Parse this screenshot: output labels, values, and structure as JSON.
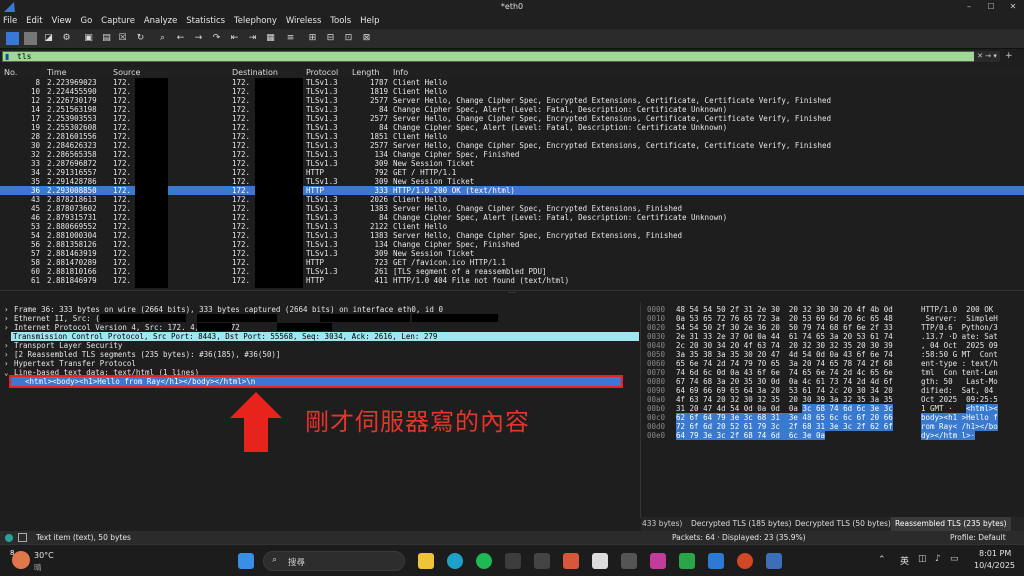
{
  "window": {
    "title": "*eth0",
    "min": "–",
    "max": "☐",
    "close": "✕"
  },
  "menu": [
    "File",
    "Edit",
    "View",
    "Go",
    "Capture",
    "Analyze",
    "Statistics",
    "Telephony",
    "Wireless",
    "Tools",
    "Help"
  ],
  "filter": {
    "value": "tls"
  },
  "columns": {
    "no": "No.",
    "time": "Time",
    "source": "Source",
    "destination": "Destination",
    "protocol": "Protocol",
    "length": "Length",
    "info": "Info"
  },
  "packets": [
    {
      "no": "8",
      "time": "2.223969023",
      "src": "172.",
      "dst": "172.",
      "proto": "TLSv1.3",
      "len": "1787",
      "info": "Client Hello"
    },
    {
      "no": "10",
      "time": "2.224455590",
      "src": "172.",
      "dst": "172.",
      "proto": "TLSv1.3",
      "len": "1819",
      "info": "Client Hello"
    },
    {
      "no": "12",
      "time": "2.226730179",
      "src": "172.",
      "dst": "172.",
      "proto": "TLSv1.3",
      "len": "2577",
      "info": "Server Hello, Change Cipher Spec, Encrypted Extensions, Certificate, Certificate Verify, Finished"
    },
    {
      "no": "14",
      "time": "2.251563198",
      "src": "172.",
      "dst": "172.",
      "proto": "TLSv1.3",
      "len": "84",
      "info": "Change Cipher Spec, Alert (Level: Fatal, Description: Certificate Unknown)"
    },
    {
      "no": "17",
      "time": "2.253903553",
      "src": "172.",
      "dst": "172.",
      "proto": "TLSv1.3",
      "len": "2577",
      "info": "Server Hello, Change Cipher Spec, Encrypted Extensions, Certificate, Certificate Verify, Finished"
    },
    {
      "no": "19",
      "time": "2.255302608",
      "src": "172.",
      "dst": "172.",
      "proto": "TLSv1.3",
      "len": "84",
      "info": "Change Cipher Spec, Alert (Level: Fatal, Description: Certificate Unknown)"
    },
    {
      "no": "28",
      "time": "2.281601556",
      "src": "172.",
      "dst": "172.",
      "proto": "TLSv1.3",
      "len": "1851",
      "info": "Client Hello"
    },
    {
      "no": "30",
      "time": "2.284626323",
      "src": "172.",
      "dst": "172.",
      "proto": "TLSv1.3",
      "len": "2577",
      "info": "Server Hello, Change Cipher Spec, Encrypted Extensions, Certificate, Certificate Verify, Finished"
    },
    {
      "no": "32",
      "time": "2.286565358",
      "src": "172.",
      "dst": "172.",
      "proto": "TLSv1.3",
      "len": "134",
      "info": "Change Cipher Spec, Finished"
    },
    {
      "no": "33",
      "time": "2.287696872",
      "src": "172.",
      "dst": "172.",
      "proto": "TLSv1.3",
      "len": "309",
      "info": "New Session Ticket"
    },
    {
      "no": "34",
      "time": "2.291316557",
      "src": "172.",
      "dst": "172.",
      "proto": "HTTP",
      "len": "792",
      "info": "GET / HTTP/1.1"
    },
    {
      "no": "35",
      "time": "2.291428786",
      "src": "172.",
      "dst": "172.",
      "proto": "TLSv1.3",
      "len": "309",
      "info": "New Session Ticket"
    },
    {
      "no": "36",
      "time": "2.293008850",
      "src": "172.",
      "dst": "172.",
      "proto": "HTTP",
      "len": "333",
      "info": "HTTP/1.0 200 OK  (text/html)"
    },
    {
      "no": "43",
      "time": "2.878218613",
      "src": "172.",
      "dst": "172.",
      "proto": "TLSv1.3",
      "len": "2026",
      "info": "Client Hello"
    },
    {
      "no": "45",
      "time": "2.878073602",
      "src": "172.",
      "dst": "172.",
      "proto": "TLSv1.3",
      "len": "1383",
      "info": "Server Hello, Change Cipher Spec, Encrypted Extensions, Finished"
    },
    {
      "no": "46",
      "time": "2.879315731",
      "src": "172.",
      "dst": "172.",
      "proto": "TLSv1.3",
      "len": "84",
      "info": "Change Cipher Spec, Alert (Level: Fatal, Description: Certificate Unknown)"
    },
    {
      "no": "53",
      "time": "2.880669552",
      "src": "172.",
      "dst": "172.",
      "proto": "TLSv1.3",
      "len": "2122",
      "info": "Client Hello"
    },
    {
      "no": "54",
      "time": "2.881000304",
      "src": "172.",
      "dst": "172.",
      "proto": "TLSv1.3",
      "len": "1383",
      "info": "Server Hello, Change Cipher Spec, Encrypted Extensions, Finished"
    },
    {
      "no": "56",
      "time": "2.881358126",
      "src": "172.",
      "dst": "172.",
      "proto": "TLSv1.3",
      "len": "134",
      "info": "Change Cipher Spec, Finished"
    },
    {
      "no": "57",
      "time": "2.881463919",
      "src": "172.",
      "dst": "172.",
      "proto": "TLSv1.3",
      "len": "309",
      "info": "New Session Ticket"
    },
    {
      "no": "58",
      "time": "2.881470289",
      "src": "172.",
      "dst": "172.",
      "proto": "HTTP",
      "len": "723",
      "info": "GET /favicon.ico HTTP/1.1"
    },
    {
      "no": "60",
      "time": "2.881810166",
      "src": "172.",
      "dst": "172.",
      "proto": "TLSv1.3",
      "len": "261",
      "info": "[TLS segment of a reassembled PDU]"
    },
    {
      "no": "61",
      "time": "2.881846979",
      "src": "172.",
      "dst": "172.",
      "proto": "HTTP",
      "len": "411",
      "info": "HTTP/1.0 404 File not found  (text/html)"
    }
  ],
  "selected_packet": "36",
  "details": [
    {
      "text": "Frame 36: 333 bytes on wire (2664 bits), 333 bytes captured (2664 bits) on interface eth0, id 0",
      "indent": 0,
      "arrow": "›",
      "hl": ""
    },
    {
      "text": "Ethernet II, Src:                     (                  ), Dst:                    (                  )",
      "indent": 0,
      "arrow": "›",
      "hl": ""
    },
    {
      "text": "Internet Protocol Version 4, Src: 172.          4, Dst: 172",
      "indent": 0,
      "arrow": "›",
      "hl": ""
    },
    {
      "text": "Transmission Control Protocol, Src Port: 8443, Dst Port: 55568, Seq: 3034, Ack: 2616, Len: 279",
      "indent": 0,
      "arrow": "›",
      "hl": "cyan"
    },
    {
      "text": "Transport Layer Security",
      "indent": 0,
      "arrow": "›",
      "hl": ""
    },
    {
      "text": "[2 Reassembled TLS segments (235 bytes): #36(185), #36(50)]",
      "indent": 0,
      "arrow": "›",
      "hl": ""
    },
    {
      "text": "Hypertext Transfer Protocol",
      "indent": 0,
      "arrow": "›",
      "hl": ""
    },
    {
      "text": "Line-based text data: text/html (1 lines)",
      "indent": 0,
      "arrow": "⌄",
      "hl": ""
    },
    {
      "text": "<html><body><h1>Hello from Ray</h1></body></html>\\n",
      "indent": 1,
      "arrow": "",
      "hl": "sel"
    }
  ],
  "hex": [
    {
      "off": "0000",
      "bytes": "48 54 54 50 2f 31 2e 30  20 32 30 30 20 4f 4b 0d",
      "ascii": "HTTP/1.0  200 OK"
    },
    {
      "off": "0010",
      "bytes": "0a 53 65 72 76 65 72 3a  20 53 69 6d 70 6c 65 48",
      "ascii": " Server:  SimpleH"
    },
    {
      "off": "0020",
      "bytes": "54 54 50 2f 30 2e 36 20  50 79 74 68 6f 6e 2f 33",
      "ascii": "TTP/0.6  Python/3"
    },
    {
      "off": "0030",
      "bytes": "2e 31 33 2e 37 0d 0a 44  61 74 65 3a 20 53 61 74",
      "ascii": ".13.7 ·D ate: Sat"
    },
    {
      "off": "0040",
      "bytes": "2c 20 30 34 20 4f 63 74  20 32 30 32 35 20 30 39",
      "ascii": ", 04 Oct  2025 09"
    },
    {
      "off": "0050",
      "bytes": "3a 35 38 3a 35 30 20 47  4d 54 0d 0a 43 6f 6e 74",
      "ascii": ":58:50 G MT  Cont"
    },
    {
      "off": "0060",
      "bytes": "65 6e 74 2d 74 79 70 65  3a 20 74 65 78 74 2f 68",
      "ascii": "ent-type : text/h"
    },
    {
      "off": "0070",
      "bytes": "74 6d 6c 0d 0a 43 6f 6e  74 65 6e 74 2d 4c 65 6e",
      "ascii": "tml  Con tent-Len"
    },
    {
      "off": "0080",
      "bytes": "67 74 68 3a 20 35 30 0d  0a 4c 61 73 74 2d 4d 6f",
      "ascii": "gth: 50   Last-Mo"
    },
    {
      "off": "0090",
      "bytes": "64 69 66 69 65 64 3a 20  53 61 74 2c 20 30 34 20",
      "ascii": "dified:  Sat, 04"
    },
    {
      "off": "00a0",
      "bytes": "4f 63 74 20 32 30 32 35  20 30 39 3a 32 35 3a 35",
      "ascii": "Oct 2025  09:25:5"
    },
    {
      "off": "00b0",
      "bytes": "31 20 47 4d 54 0d 0a 0d  0a 3c 68 74 6d 6c 3e 3c",
      "ascii": "1 GMT ·   <html><"
    },
    {
      "off": "00c0",
      "bytes": "62 6f 64 79 3e 3c 68 31  3e 48 65 6c 6c 6f 20 66",
      "ascii": "body><h1 >Hello f"
    },
    {
      "off": "00d0",
      "bytes": "72 6f 6d 20 52 61 79 3c  2f 68 31 3e 3c 2f 62 6f",
      "ascii": "rom Ray< /h1></bo"
    },
    {
      "off": "00e0",
      "bytes": "64 79 3e 3c 2f 68 74 6d  6c 3e 0a",
      "ascii": "dy></htm l>·"
    }
  ],
  "annotation": "剛才伺服器寫的內容",
  "byte_tabs": [
    "433 bytes)",
    "Decrypted TLS (185 bytes)",
    "Decrypted TLS (50 bytes)",
    "Reassembled TLS (235 bytes)"
  ],
  "status": {
    "left": "Text item (text), 50 bytes",
    "mid": "Packets: 64 · Displayed: 23 (35.9%)",
    "right": "Profile: Default"
  },
  "taskbar": {
    "weather_temp": "30°C",
    "weather_desc": "晴",
    "search": "搜尋",
    "ime": "英",
    "time": "8:01 PM",
    "date": "10/4/2025",
    "badge": "8"
  }
}
